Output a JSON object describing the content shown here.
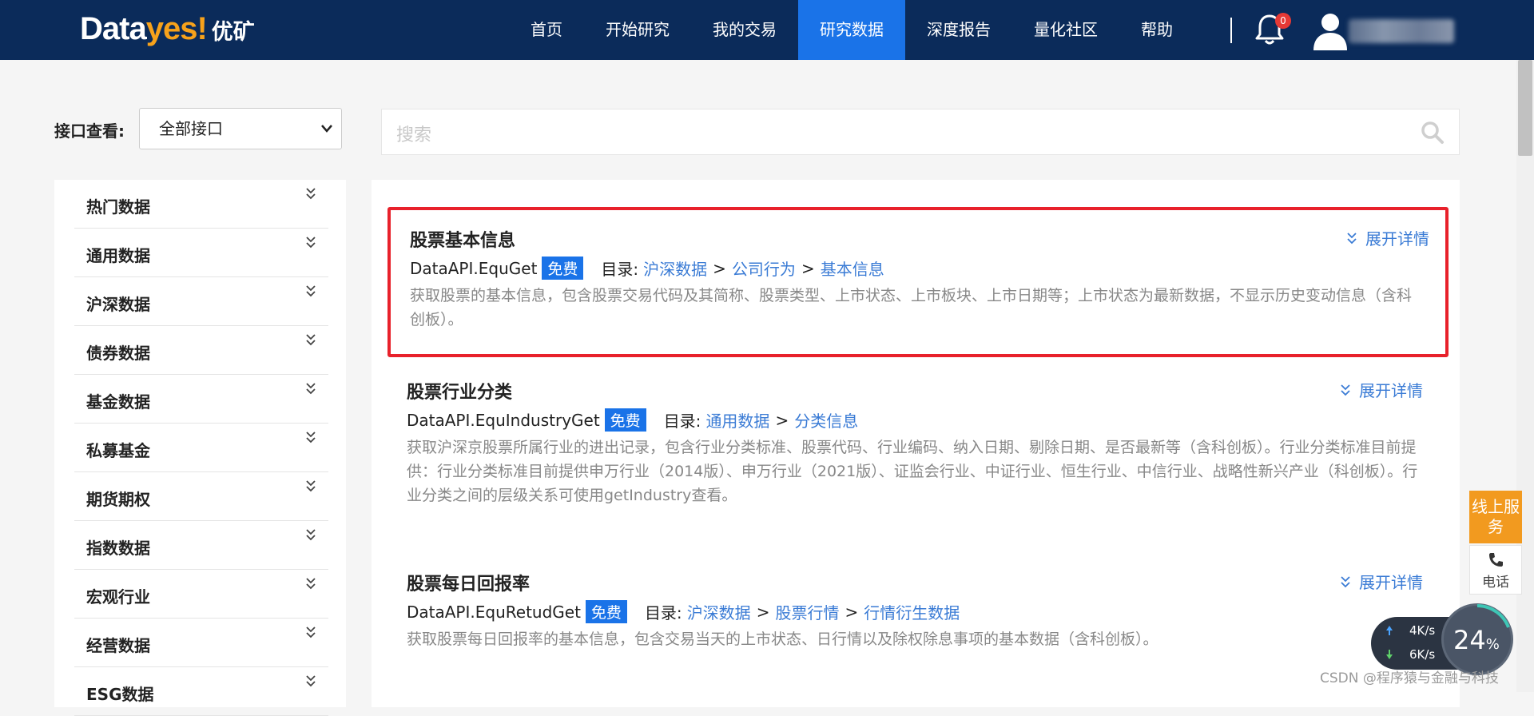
{
  "logo": {
    "part1": "Data",
    "part2": "yes!",
    "part3": "优矿"
  },
  "nav": {
    "items": [
      {
        "label": "首页"
      },
      {
        "label": "开始研究"
      },
      {
        "label": "我的交易"
      },
      {
        "label": "研究数据",
        "active": true
      },
      {
        "label": "深度报告"
      },
      {
        "label": "量化社区"
      },
      {
        "label": "帮助"
      }
    ],
    "notification_count": "0"
  },
  "filter": {
    "label": "接口查看:",
    "selected": "全部接口"
  },
  "search": {
    "placeholder": "搜索"
  },
  "sidebar": {
    "items": [
      {
        "label": "热门数据"
      },
      {
        "label": "通用数据"
      },
      {
        "label": "沪深数据"
      },
      {
        "label": "债券数据"
      },
      {
        "label": "基金数据"
      },
      {
        "label": "私募基金"
      },
      {
        "label": "期货期权"
      },
      {
        "label": "指数数据"
      },
      {
        "label": "宏观行业"
      },
      {
        "label": "经营数据"
      },
      {
        "label": "ESG数据"
      }
    ]
  },
  "cards": [
    {
      "title": "股票基本信息",
      "expand": "展开详情",
      "api": "DataAPI.EquGet",
      "badge": "免费",
      "dir_label": "目录:",
      "path": [
        "沪深数据",
        "公司行为",
        "基本信息"
      ],
      "desc": "获取股票的基本信息，包含股票交易代码及其简称、股票类型、上市状态、上市板块、上市日期等；上市状态为最新数据，不显示历史变动信息（含科创板）。"
    },
    {
      "title": "股票行业分类",
      "expand": "展开详情",
      "api": "DataAPI.EquIndustryGet",
      "badge": "免费",
      "dir_label": "目录:",
      "path": [
        "通用数据",
        "分类信息"
      ],
      "desc": "获取沪深京股票所属行业的进出记录，包含行业分类标准、股票代码、行业编码、纳入日期、剔除日期、是否最新等（含科创板）。行业分类标准目前提供：行业分类标准目前提供申万行业（2014版）、申万行业（2021版）、证监会行业、中证行业、恒生行业、中信行业、战略性新兴产业（科创板）。行业分类之间的层级关系可使用getIndustry查看。"
    },
    {
      "title": "股票每日回报率",
      "expand": "展开详情",
      "api": "DataAPI.EquRetudGet",
      "badge": "免费",
      "dir_label": "目录:",
      "path": [
        "沪深数据",
        "股票行情",
        "行情衍生数据"
      ],
      "desc": "获取股票每日回报率的基本信息，包含交易当天的上市状态、日行情以及除权除息事项的基本数据（含科创板）。"
    }
  ],
  "floating": {
    "service_label": "线上服务",
    "phone_label": "电话",
    "up_speed": "4K/s",
    "down_speed": "6K/s",
    "cpu_percent": "24",
    "percent_sign": "%"
  },
  "watermark": "CSDN @程序猿与金融与科技",
  "colors": {
    "nav_bg": "#0b2b5a",
    "accent": "#1a73e8",
    "link": "#3a7bd5",
    "highlight_border": "#e8212b",
    "service": "#f29a1f"
  }
}
